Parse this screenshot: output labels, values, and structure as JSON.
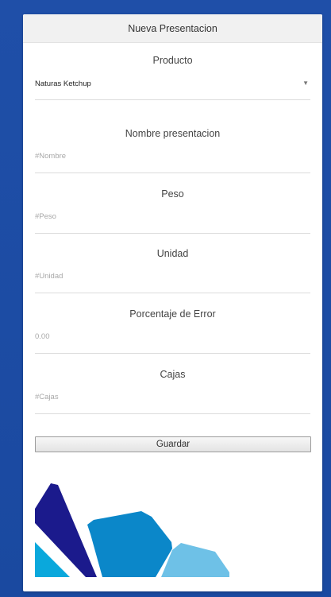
{
  "header": {
    "title": "Nueva Presentacion"
  },
  "form": {
    "producto": {
      "label": "Producto",
      "selected": "Naturas Ketchup"
    },
    "nombre": {
      "label": "Nombre presentacion",
      "placeholder": "#Nombre"
    },
    "peso": {
      "label": "Peso",
      "placeholder": "#Peso"
    },
    "unidad": {
      "label": "Unidad",
      "placeholder": "#Unidad"
    },
    "error": {
      "label": "Porcentaje de Error",
      "placeholder": "0.00"
    },
    "cajas": {
      "label": "Cajas",
      "placeholder": "#Cajas"
    }
  },
  "actions": {
    "save_label": "Guardar"
  },
  "colors": {
    "background": "#1f4fa8",
    "logo_dark": "#1b1a8c",
    "logo_mid": "#0b87c9",
    "logo_light": "#6ec1e7",
    "logo_cyan": "#0aa8dc"
  }
}
